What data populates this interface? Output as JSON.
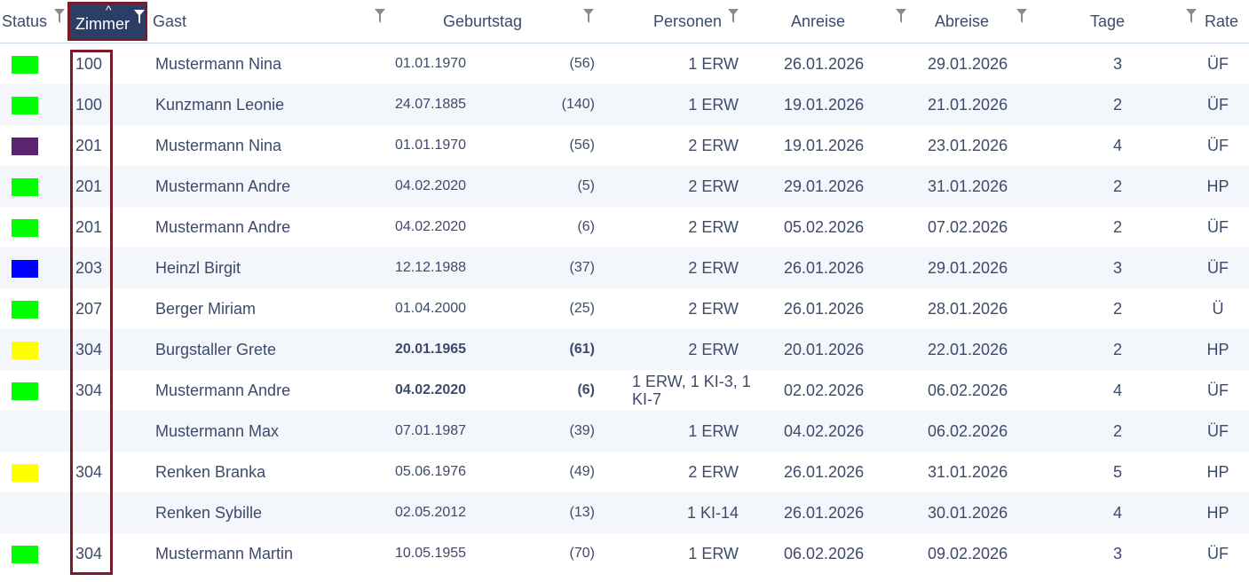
{
  "header": {
    "status": "Status",
    "zimmer": "Zimmer",
    "gast": "Gast",
    "geburtstag": "Geburtstag",
    "personen": "Personen",
    "anreise": "Anreise",
    "abreise": "Abreise",
    "tage": "Tage",
    "rate": "Rate",
    "sort_indicator": "^"
  },
  "colors": {
    "green": "#00ff00",
    "purple": "#5b2370",
    "blue": "#0000ff",
    "yellow": "#ffff00",
    "highlight_border": "#7a1b2a",
    "header_active_bg": "#2b3f66"
  },
  "rows": [
    {
      "status": "green",
      "zimmer": "100",
      "gast": "Mustermann Nina",
      "geburtstag": "01.01.1970",
      "alter": "(56)",
      "personen": "1 ERW",
      "anreise": "26.01.2026",
      "abreise": "29.01.2026",
      "tage": "3",
      "rate": "ÜF"
    },
    {
      "status": "green",
      "zimmer": "100",
      "gast": "Kunzmann Leonie",
      "geburtstag": "24.07.1885",
      "alter": "(140)",
      "personen": "1 ERW",
      "anreise": "19.01.2026",
      "abreise": "21.01.2026",
      "tage": "2",
      "rate": "ÜF"
    },
    {
      "status": "purple",
      "zimmer": "201",
      "gast": "Mustermann Nina",
      "geburtstag": "01.01.1970",
      "alter": "(56)",
      "personen": "2 ERW",
      "anreise": "19.01.2026",
      "abreise": "23.01.2026",
      "tage": "4",
      "rate": "ÜF"
    },
    {
      "status": "green",
      "zimmer": "201",
      "gast": "Mustermann Andre",
      "geburtstag": "04.02.2020",
      "alter": "(5)",
      "personen": "2 ERW",
      "anreise": "29.01.2026",
      "abreise": "31.01.2026",
      "tage": "2",
      "rate": "HP"
    },
    {
      "status": "green",
      "zimmer": "201",
      "gast": "Mustermann Andre",
      "geburtstag": "04.02.2020",
      "alter": "(6)",
      "personen": "2 ERW",
      "anreise": "05.02.2026",
      "abreise": "07.02.2026",
      "tage": "2",
      "rate": "ÜF"
    },
    {
      "status": "blue",
      "zimmer": "203",
      "gast": "Heinzl Birgit",
      "geburtstag": "12.12.1988",
      "alter": "(37)",
      "personen": "2 ERW",
      "anreise": "26.01.2026",
      "abreise": "29.01.2026",
      "tage": "3",
      "rate": "ÜF"
    },
    {
      "status": "green",
      "zimmer": "207",
      "gast": "Berger Miriam",
      "geburtstag": "01.04.2000",
      "alter": "(25)",
      "personen": "2 ERW",
      "anreise": "26.01.2026",
      "abreise": "28.01.2026",
      "tage": "2",
      "rate": "Ü"
    },
    {
      "status": "yellow",
      "zimmer": "304",
      "gast": "Burgstaller Grete",
      "geburtstag": "20.01.1965",
      "alter": "(61)",
      "personen": "2 ERW",
      "anreise": "20.01.2026",
      "abreise": "22.01.2026",
      "tage": "2",
      "rate": "HP",
      "bold": true
    },
    {
      "status": "green",
      "zimmer": "304",
      "gast": "Mustermann Andre",
      "geburtstag": "04.02.2020",
      "alter": "(6)",
      "personen": "1 ERW, 1 KI-3, 1 KI-7",
      "anreise": "02.02.2026",
      "abreise": "06.02.2026",
      "tage": "4",
      "rate": "ÜF",
      "bold": true,
      "multiline": true
    },
    {
      "status": "",
      "zimmer": "",
      "gast": "Mustermann Max",
      "geburtstag": "07.01.1987",
      "alter": "(39)",
      "personen": "1 ERW",
      "anreise": "04.02.2026",
      "abreise": "06.02.2026",
      "tage": "2",
      "rate": "ÜF"
    },
    {
      "status": "yellow",
      "zimmer": "304",
      "gast": "Renken Branka",
      "geburtstag": "05.06.1976",
      "alter": "(49)",
      "personen": "2 ERW",
      "anreise": "26.01.2026",
      "abreise": "31.01.2026",
      "tage": "5",
      "rate": "HP"
    },
    {
      "status": "",
      "zimmer": "",
      "gast": "Renken Sybille",
      "geburtstag": "02.05.2012",
      "alter": "(13)",
      "personen": "1 KI-14",
      "anreise": "26.01.2026",
      "abreise": "30.01.2026",
      "tage": "4",
      "rate": "HP"
    },
    {
      "status": "green",
      "zimmer": "304",
      "gast": "Mustermann Martin",
      "geburtstag": "10.05.1955",
      "alter": "(70)",
      "personen": "1 ERW",
      "anreise": "06.02.2026",
      "abreise": "09.02.2026",
      "tage": "3",
      "rate": "ÜF"
    }
  ]
}
